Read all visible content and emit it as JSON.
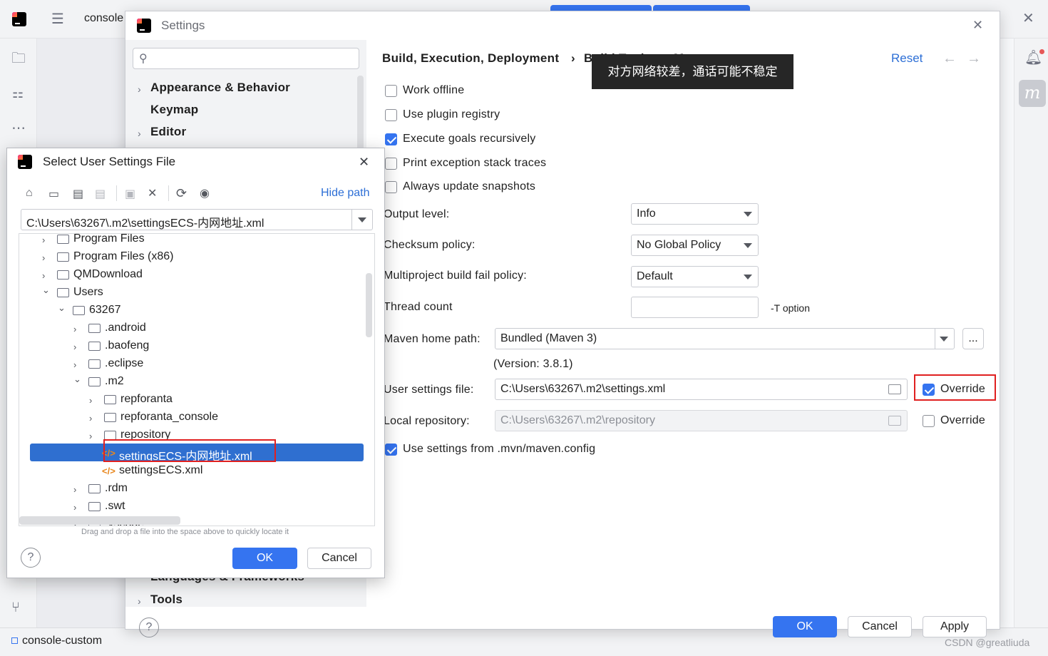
{
  "ide": {
    "project_label": "console",
    "status_project": "console-custom",
    "watermark": "CSDN @greatliuda",
    "right_plugin_label": "m"
  },
  "settings": {
    "title": "Settings",
    "search_placeholder": "",
    "nav": {
      "appearance": "Appearance & Behavior",
      "keymap": "Keymap",
      "editor": "Editor",
      "languages": "Languages & Frameworks",
      "tools": "Tools"
    },
    "breadcrumb": {
      "part1": "Build, Execution, Deployment",
      "part2": "Build Tools",
      "part3": "Maven",
      "sep": "›"
    },
    "reset_label": "Reset",
    "options": {
      "work_offline": {
        "label": "Work offline",
        "checked": false
      },
      "use_plugin_registry": {
        "label": "Use plugin registry",
        "checked": false
      },
      "execute_goals": {
        "label": "Execute goals recursively",
        "checked": true
      },
      "print_exception": {
        "label": "Print exception stack traces",
        "checked": false
      },
      "always_update": {
        "label": "Always update snapshots",
        "checked": false
      }
    },
    "output_level": {
      "label": "Output level:",
      "value": "Info"
    },
    "checksum_policy": {
      "label": "Checksum policy:",
      "value": "No Global Policy"
    },
    "fail_policy": {
      "label": "Multiproject build fail policy:",
      "value": "Default"
    },
    "thread_count": {
      "label": "Thread count",
      "value": "",
      "suffix": "-T option"
    },
    "maven_home": {
      "label": "Maven home path:",
      "value": "Bundled (Maven 3)",
      "browse": "...",
      "version": "(Version: 3.8.1)"
    },
    "user_settings": {
      "label": "User settings file:",
      "value": "C:\\Users\\63267\\.m2\\settings.xml",
      "override_label": "Override",
      "override_checked": true
    },
    "local_repo": {
      "label": "Local repository:",
      "value": "C:\\Users\\63267\\.m2\\repository",
      "override_label": "Override",
      "override_checked": false
    },
    "use_mvn_config": {
      "label": "Use settings from .mvn/maven.config",
      "checked": true
    },
    "buttons": {
      "ok": "OK",
      "cancel": "Cancel",
      "apply": "Apply"
    },
    "help": "?"
  },
  "toast": {
    "text": "对方网络较差，通话可能不稳定"
  },
  "chooser": {
    "title": "Select User Settings File",
    "hide_path": "Hide path",
    "path_value": "C:\\Users\\63267\\.m2\\settingsECS-内网地址.xml",
    "tree": [
      {
        "label": "Program Files",
        "expanded": false
      },
      {
        "label": "Program Files (x86)",
        "expanded": false
      },
      {
        "label": "QMDownload",
        "expanded": false
      },
      {
        "label": "Users",
        "expanded": true
      },
      {
        "label": "63267",
        "expanded": true
      },
      {
        "label": ".android",
        "expanded": false
      },
      {
        "label": ".baofeng",
        "expanded": false
      },
      {
        "label": ".eclipse",
        "expanded": false
      },
      {
        "label": ".m2",
        "expanded": true
      },
      {
        "label": "repforanta",
        "expanded": false
      },
      {
        "label": "repforanta_console",
        "expanded": false
      },
      {
        "label": "repository",
        "expanded": false
      },
      {
        "label": "settingsECS-内网地址.xml",
        "selected": true
      },
      {
        "label": "settingsECS.xml",
        "selected": false
      },
      {
        "label": ".rdm",
        "expanded": false
      },
      {
        "label": ".swt",
        "expanded": false
      },
      {
        "label": ".vscode",
        "expanded": false
      }
    ],
    "hint": "Drag and drop a file into the space above to quickly locate it",
    "ok": "OK",
    "cancel": "Cancel",
    "help": "?",
    "close": "✕"
  },
  "colors": {
    "accent": "#3574f0",
    "selection": "#2f6fd0",
    "highlight_box": "#e02020",
    "toast_bg": "#262626"
  },
  "icons": [
    "search-icon",
    "home-icon",
    "desktop-icon",
    "new-folder-icon",
    "delete-icon",
    "refresh-icon",
    "show-hidden-icon",
    "folder-icon",
    "xml-file-icon",
    "bell-icon",
    "close-icon",
    "back-icon",
    "forward-icon",
    "help-icon"
  ]
}
